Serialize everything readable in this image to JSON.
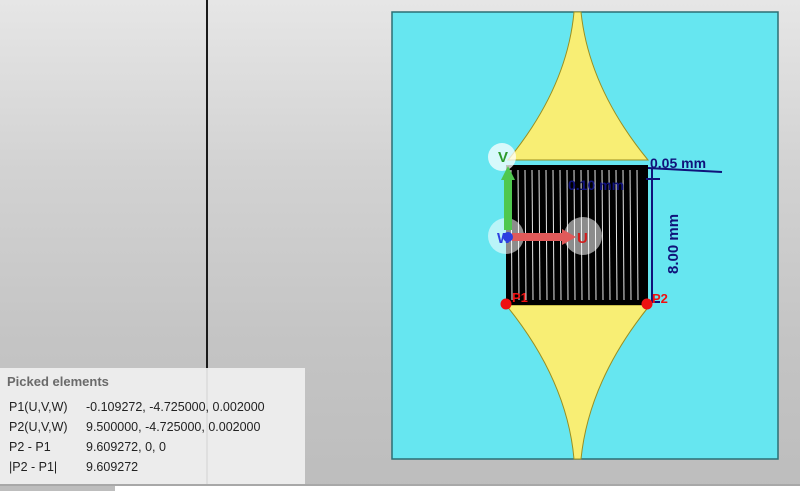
{
  "picked": {
    "title": "Picked elements",
    "rows": [
      {
        "label": "P1(U,V,W)",
        "value": "-0.109272, -4.725000, 0.002000"
      },
      {
        "label": "P2(U,V,W)",
        "value": "9.500000, -4.725000, 0.002000"
      },
      {
        "label": "P2 - P1",
        "value": "9.609272, 0, 0"
      },
      {
        "label": "|P2 - P1|",
        "value": "9.609272"
      }
    ]
  },
  "axes": {
    "u": "U",
    "v": "V",
    "w": "W"
  },
  "points": {
    "p1": "P1",
    "p2": "P2"
  },
  "dimensions": {
    "height": "8.00 mm",
    "gap": "0.10 mm",
    "top": "0.05 mm"
  },
  "colors": {
    "substrate": "#66e6f0",
    "metal": "#f8ee74",
    "pad": "#000000",
    "point": "#ee1111",
    "dimension": "#10127a",
    "axis_u": "#e05a5a",
    "axis_v": "#4fc84f",
    "axis_w": "#2d3fe0"
  }
}
